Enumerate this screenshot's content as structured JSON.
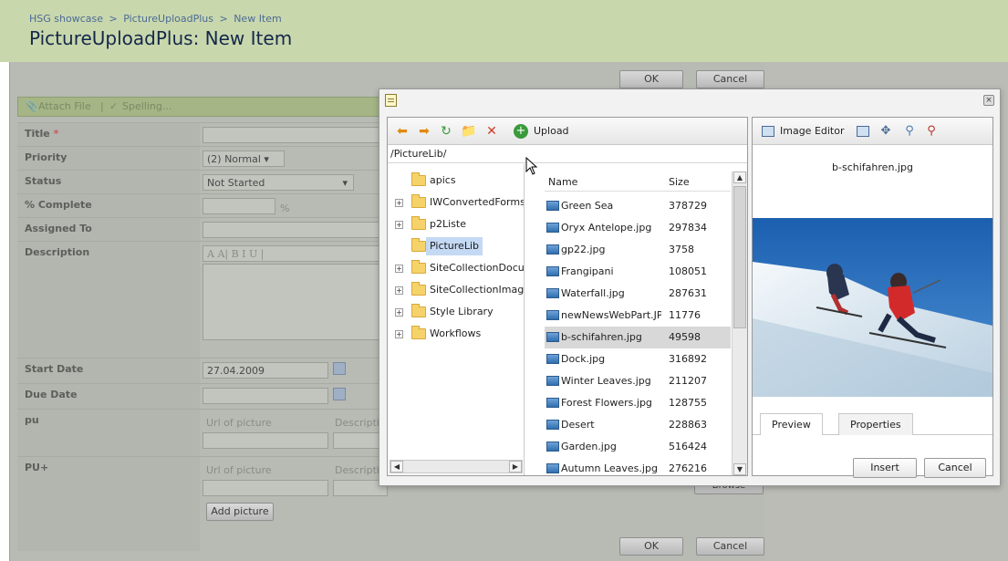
{
  "breadcrumb": {
    "site": "HSG showcase",
    "sep": ">",
    "list": "PictureUploadPlus",
    "item": "New Item"
  },
  "page_title": "PictureUploadPlus: New Item",
  "top_buttons": {
    "ok": "OK",
    "cancel": "Cancel"
  },
  "bottom_buttons": {
    "ok": "OK",
    "cancel": "Cancel"
  },
  "form_toolbar": {
    "attach": "Attach File",
    "spelling": "Spelling..."
  },
  "fields": {
    "title": {
      "label": "Title",
      "required": "*"
    },
    "priority": {
      "label": "Priority",
      "value": "(2) Normal"
    },
    "status": {
      "label": "Status",
      "value": "Not Started"
    },
    "complete": {
      "label": "% Complete",
      "unit": "%"
    },
    "assigned": {
      "label": "Assigned To"
    },
    "description": {
      "label": "Description",
      "rte_buttons": "A  A| B  I  U |"
    },
    "start_date": {
      "label": "Start Date",
      "value": "27.04.2009"
    },
    "due_date": {
      "label": "Due Date"
    },
    "pu": {
      "label": "pu",
      "url_placeholder": "Url of picture",
      "desc_placeholder": "Descripti"
    },
    "puplus": {
      "label": "PU+",
      "url_placeholder": "Url of picture",
      "desc_placeholder": "Descripti",
      "add_button": "Add picture",
      "browse_button": "Browse"
    }
  },
  "dialog": {
    "toolbar": {
      "upload": "Upload"
    },
    "path": "/PictureLib/",
    "tree": [
      {
        "label": "apics",
        "expandable": false
      },
      {
        "label": "IWConvertedForms",
        "expandable": true
      },
      {
        "label": "p2Liste",
        "expandable": true
      },
      {
        "label": "PictureLib",
        "expandable": false,
        "selected": true
      },
      {
        "label": "SiteCollectionDocur",
        "expandable": true
      },
      {
        "label": "SiteCollectionImage",
        "expandable": true
      },
      {
        "label": "Style Library",
        "expandable": true
      },
      {
        "label": "Workflows",
        "expandable": true
      }
    ],
    "columns": {
      "name": "Name",
      "size": "Size"
    },
    "files": [
      {
        "name": "Green Sea",
        "size": "378729"
      },
      {
        "name": "Oryx Antelope.jpg",
        "size": "297834"
      },
      {
        "name": "gp22.jpg",
        "size": "3758"
      },
      {
        "name": "Frangipani",
        "size": "108051"
      },
      {
        "name": "Waterfall.jpg",
        "size": "287631"
      },
      {
        "name": "newNewsWebPart.JPG",
        "size": "11776"
      },
      {
        "name": "b-schifahren.jpg",
        "size": "49598",
        "selected": true
      },
      {
        "name": "Dock.jpg",
        "size": "316892"
      },
      {
        "name": "Winter Leaves.jpg",
        "size": "211207"
      },
      {
        "name": "Forest Flowers.jpg",
        "size": "128755"
      },
      {
        "name": "Desert",
        "size": "228863"
      },
      {
        "name": "Garden.jpg",
        "size": "516424"
      },
      {
        "name": "Autumn Leaves.jpg",
        "size": "276216"
      }
    ],
    "preview": {
      "image_editor": "Image Editor",
      "filename": "b-schifahren.jpg",
      "tabs": {
        "preview": "Preview",
        "properties": "Properties"
      },
      "insert": "Insert",
      "cancel": "Cancel"
    }
  },
  "colors": {
    "header_bg": "#c9d7ad",
    "title": "#14284a",
    "link": "#4a6b96",
    "selection": "#c4d9f3"
  }
}
